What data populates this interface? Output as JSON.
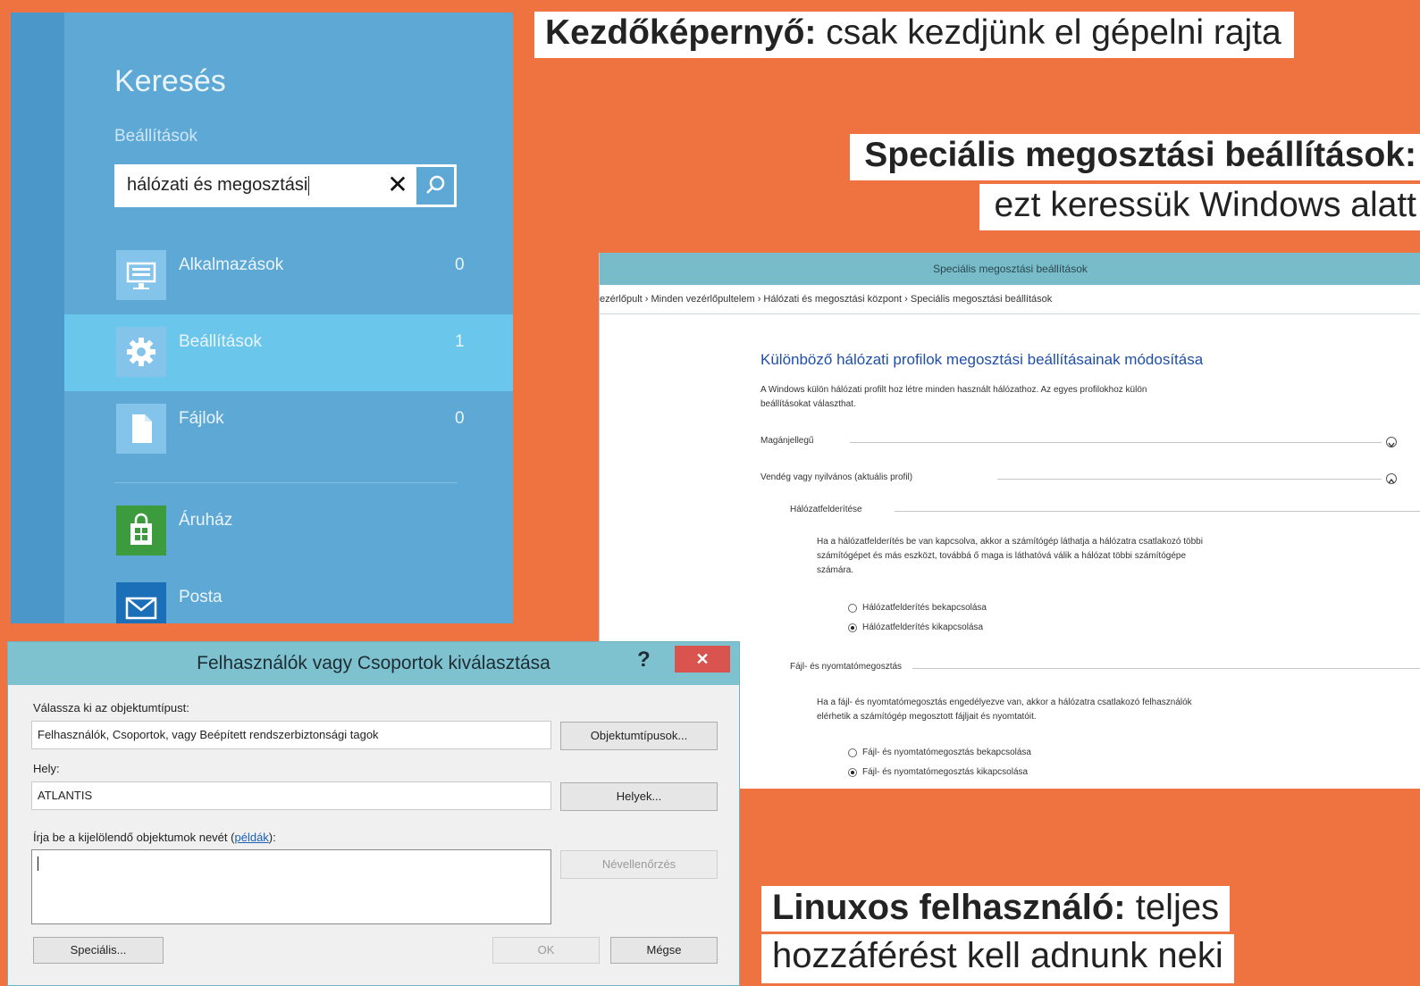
{
  "captions": {
    "start_bold": "Kezdőképernyő:",
    "start_rest": " csak kezdjünk el gépelni rajta",
    "special_bold": "Speciális megosztási beállítások:",
    "special_line2": "ezt keressük Windows alatt",
    "linux_bold": "Linuxos felhasználó:",
    "linux_rest": " teljes",
    "linux_line2": "hozzáférést kell adnunk neki"
  },
  "search_charm": {
    "title": "Keresés",
    "scope": "Beállítások",
    "query": "hálózati és megosztási",
    "results": [
      {
        "label": "Alkalmazások",
        "count": "0",
        "icon": "keyboard-monitor-icon"
      },
      {
        "label": "Beállítások",
        "count": "1",
        "icon": "gear-icon"
      },
      {
        "label": "Fájlok",
        "count": "0",
        "icon": "document-icon"
      }
    ],
    "apps": [
      {
        "label": "Áruház",
        "icon": "store-bag-icon"
      },
      {
        "label": "Posta",
        "icon": "mail-envelope-icon"
      }
    ]
  },
  "advanced_sharing": {
    "window_title": "Speciális megosztási beállítások",
    "breadcrumb": "ezérlőpult  ›  Minden vezérlőpultelem  ›  Hálózati és megosztási központ  ›  Speciális megosztási beállítások",
    "heading": "Különböző hálózati profilok megosztási beállításainak módosítása",
    "intro_1": "A Windows külön hálózati profilt hoz létre minden használt hálózathoz. Az egyes profilokhoz külön",
    "intro_2": "beállításokat választhat.",
    "profile_private": "Magánjellegű",
    "profile_guest": "Vendég vagy nyilvános (aktuális profil)",
    "discovery": {
      "title": "Hálózatfelderítése",
      "desc_1": "Ha a hálózatfelderítés be van kapcsolva, akkor a számítógép láthatja a hálózatra csatlakozó többi",
      "desc_2": "számítógépet és más eszközt, továbbá ő maga is láthatóvá válik a hálózat többi számítógépe",
      "desc_3": "számára.",
      "opt_on": "Hálózatfelderítés bekapcsolása",
      "opt_off": "Hálózatfelderítés kikapcsolása",
      "selected": "off"
    },
    "file_print": {
      "title": "Fájl- és nyomtatómegosztás",
      "desc_1": "Ha a fájl- és nyomtatómegosztás engedélyezve van, akkor a hálózatra csatlakozó felhasználók",
      "desc_2": "elérhetik a számítógép megosztott fájljait és nyomtatóit.",
      "opt_on": "Fájl- és nyomtatómegosztás bekapcsolása",
      "opt_off": "Fájl- és nyomtatómegosztás kikapcsolása",
      "selected": "off"
    }
  },
  "select_users_dialog": {
    "title": "Felhasználók vagy Csoportok kiválasztása",
    "help": "?",
    "close": "✕",
    "objtype_label": "Válassza ki az objektumtípust:",
    "objtype_value": "Felhasználók, Csoportok, vagy Beépített rendszerbiztonsági tagok",
    "objtype_button": "Objektumtípusok...",
    "location_label": "Hely:",
    "location_value": "ATLANTIS",
    "location_button": "Helyek...",
    "names_label": "Írja be a kijelölendő objektumok nevét",
    "names_label_link": "példák",
    "names_value": "",
    "check_names_button": "Névellenőrzés",
    "advanced_button": "Speciális...",
    "ok_button": "OK",
    "cancel_button": "Mégse"
  }
}
